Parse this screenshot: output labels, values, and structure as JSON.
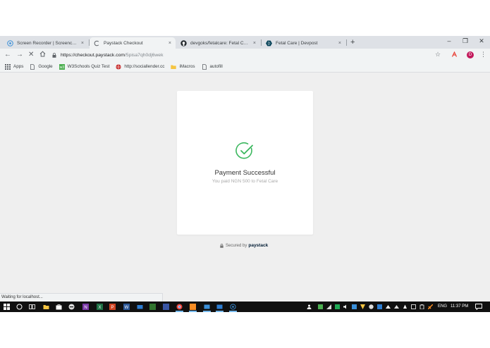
{
  "browser": {
    "tabs": [
      {
        "title": "Screen Recorder | Screencast-O-",
        "icon": "screencast-icon",
        "close": "×"
      },
      {
        "title": "Paystack Checkout",
        "icon": "loading-spinner-icon",
        "close": "×",
        "active": true
      },
      {
        "title": "devgoks/fetalcare: Fetal Care Pro",
        "icon": "github-icon",
        "close": "×"
      },
      {
        "title": "Fetal Care | Devpost",
        "icon": "devpost-icon",
        "close": "×"
      }
    ],
    "new_tab": "+",
    "window_controls": {
      "minimize": "–",
      "restore": "❐",
      "close": "✕"
    },
    "url": {
      "host": "https://checkout.paystack.com",
      "path": "/5pisa7qh0dj6wek"
    },
    "profile_initial": "D",
    "bookmarks": [
      {
        "label": "Apps",
        "icon": "apps-grid-icon"
      },
      {
        "label": "Google",
        "icon": "page-icon"
      },
      {
        "label": "W3Schools Quiz Test",
        "icon": "w3schools-icon"
      },
      {
        "label": "http://sociallender.cc",
        "icon": "globe-icon"
      },
      {
        "label": "iMacros",
        "icon": "folder-icon"
      },
      {
        "label": "autofill",
        "icon": "page-icon"
      }
    ]
  },
  "checkout": {
    "title": "Payment Successful",
    "subtitle": "You paid NGN 500 to Fetal Care",
    "secured_by": "Secured by",
    "brand": "paystack",
    "check_color": "#3bb75e"
  },
  "status_bar": "Waiting for localhost...",
  "taskbar": {
    "language": "ENG",
    "time": "11:37 PM"
  }
}
